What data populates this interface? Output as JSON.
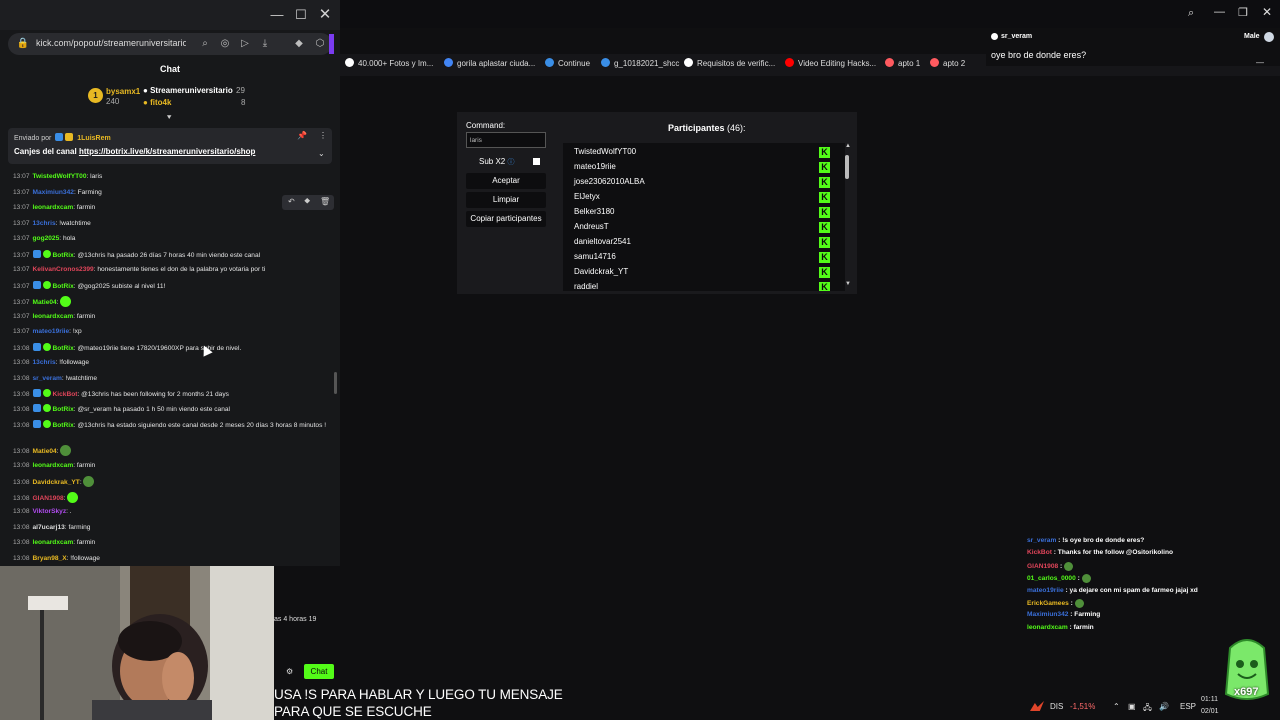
{
  "popout": {
    "url": "kick.com/popout/streameruniversitario/",
    "chat_title": "Chat",
    "top_gifters": [
      {
        "name": "bysamx1",
        "count": "240"
      },
      {
        "name": "Streameruniversitario",
        "count": "29"
      },
      {
        "name": "fito4k",
        "count": "8"
      }
    ],
    "pinned": {
      "sent_by_label": "Enviado por",
      "sent_by_user": "1LuisRem",
      "message_prefix": "Canjes del canal",
      "message_link": "https://botrix.live/k/streameruniversitario/shop"
    },
    "messages": [
      {
        "time": "13:07",
        "user": "TwistedWolfYT00",
        "color": "#53fc18",
        "text": "laris"
      },
      {
        "time": "13:07",
        "user": "Maximiun342",
        "color": "#3a6fd8",
        "text": "Farming"
      },
      {
        "time": "13:07",
        "user": "leonardxcam",
        "color": "#53fc18",
        "text": "farmin"
      },
      {
        "time": "13:07",
        "user": "13chris",
        "color": "#3a6fd8",
        "text": "!watchtime"
      },
      {
        "time": "13:07",
        "user": "gog2025",
        "color": "#53fc18",
        "text": "hola"
      },
      {
        "time": "13:07",
        "user": "BotRix",
        "color": "#53fc18",
        "text": "@13chris ha pasado 26 días 7 horas 40 min viendo este canal"
      },
      {
        "time": "13:07",
        "user": "KelivanCronos2399",
        "color": "#e0455a",
        "text": "honestamente tienes el don de la palabra yo votaria por ti"
      },
      {
        "time": "13:07",
        "user": "BotRix",
        "color": "#53fc18",
        "text": "@gog2025 subiste al nivel 11!"
      },
      {
        "time": "13:07",
        "user": "Matie04",
        "color": "#53fc18",
        "text": ""
      },
      {
        "time": "13:07",
        "user": "leonardxcam",
        "color": "#53fc18",
        "text": "farmin"
      },
      {
        "time": "13:07",
        "user": "mateo19riie",
        "color": "#3a6fd8",
        "text": "!xp"
      },
      {
        "time": "13:08",
        "user": "BotRix",
        "color": "#53fc18",
        "text": "@mateo19riie tiene 17820/19600XP para subir de nivel."
      },
      {
        "time": "13:08",
        "user": "13chris",
        "color": "#3a6fd8",
        "text": "!followage"
      },
      {
        "time": "13:08",
        "user": "sr_veram",
        "color": "#3a6fd8",
        "text": "!watchtime"
      },
      {
        "time": "13:08",
        "user": "KickBot",
        "color": "#e0455a",
        "text": "@13chris has been following for 2 months 21 days"
      },
      {
        "time": "13:08",
        "user": "BotRix",
        "color": "#53fc18",
        "text": "@sr_veram ha pasado 1 h 50 min viendo este canal"
      },
      {
        "time": "13:08",
        "user": "BotRix",
        "color": "#53fc18",
        "text": "@13chris ha estado siguiendo este canal desde 2 meses 20 días 3 horas 8 minutos !"
      },
      {
        "time": "13:08",
        "user": "Matie04",
        "color": "#e8b923",
        "text": ""
      },
      {
        "time": "13:08",
        "user": "leonardxcam",
        "color": "#53fc18",
        "text": "farmin"
      },
      {
        "time": "13:08",
        "user": "Davidckrak_YT",
        "color": "#e8b923",
        "text": ""
      },
      {
        "time": "13:08",
        "user": "GIAN1908",
        "color": "#e0455a",
        "text": ""
      },
      {
        "time": "13:08",
        "user": "ViktorSkyz",
        "color": "#b14cf0",
        "text": "."
      },
      {
        "time": "13:08",
        "user": "al7ucarj13",
        "color": "#dddddd",
        "text": "farming"
      },
      {
        "time": "13:08",
        "user": "leonardxcam",
        "color": "#53fc18",
        "text": "farmin"
      },
      {
        "time": "13:08",
        "user": "Bryan98_X",
        "color": "#e8b923",
        "text": "!followage"
      }
    ],
    "partial_text": "as 4 horas 19"
  },
  "bookmarks": [
    {
      "label": "40.000+ Fotos y Im...",
      "color": "#ffffff"
    },
    {
      "label": "gorila aplastar ciuda...",
      "color": "#4285f4"
    },
    {
      "label": "Continue",
      "color": "#3a8ee6"
    },
    {
      "label": "g_10182021_shcc",
      "color": "#3a8ee6"
    },
    {
      "label": "Requisitos de verific...",
      "color": "#ffffff"
    },
    {
      "label": "Video Editing Hacks...",
      "color": "#ff0000"
    },
    {
      "label": "apto 1",
      "color": "#ff5a5f"
    },
    {
      "label": "apto 2",
      "color": "#ff5a5f"
    }
  ],
  "notification": {
    "user": "sr_veram",
    "gender": "Male",
    "message": "oye bro de donde eres?"
  },
  "giveaway": {
    "command_label": "Command:",
    "command_value": "laris",
    "sub_label": "Sub X2",
    "accept": "Aceptar",
    "clear": "Limpiar",
    "copy": "Copiar participantes",
    "participants_label": "Participantes",
    "participants_count": "(46):",
    "participants": [
      "TwistedWolfYT00",
      "mateo19riie",
      "jose23062010ALBA",
      "ElJetyx",
      "Belker3180",
      "AndreusT",
      "danieltovar2541",
      "samu14716",
      "Davidckrak_YT",
      "raddiel"
    ]
  },
  "overlay_chat": [
    {
      "user": "sr_veram",
      "color": "#3a6fd8",
      "text": "!s oye bro de donde eres?"
    },
    {
      "user": "KickBot",
      "color": "#e0455a",
      "text": "Thanks for the follow @Ositorikolino"
    },
    {
      "user": "GIAN1908",
      "color": "#e0455a",
      "text": ""
    },
    {
      "user": "01_carlos_0000",
      "color": "#53fc18",
      "text": ""
    },
    {
      "user": "mateo19riie",
      "color": "#3a6fd8",
      "text": "ya dejare con mi spam de farmeo jajaj xd"
    },
    {
      "user": "ErickGamees",
      "color": "#e8b923",
      "text": ""
    },
    {
      "user": "Maximiun342",
      "color": "#3a6fd8",
      "text": "Farming"
    },
    {
      "user": "leonardxcam",
      "color": "#53fc18",
      "text": "farmin"
    }
  ],
  "stream": {
    "chat_button": "Chat",
    "subtitle_line1": "USA !S PARA HABLAR Y LUEGO TU MENSAJE",
    "subtitle_line2": "PARA QUE SE ESCUCHE",
    "mascot_count": "x697"
  },
  "taskbar": {
    "stock_name": "DIS",
    "stock_change": "-1,51%",
    "language": "ESP",
    "time": "01:11",
    "date": "02/01"
  }
}
